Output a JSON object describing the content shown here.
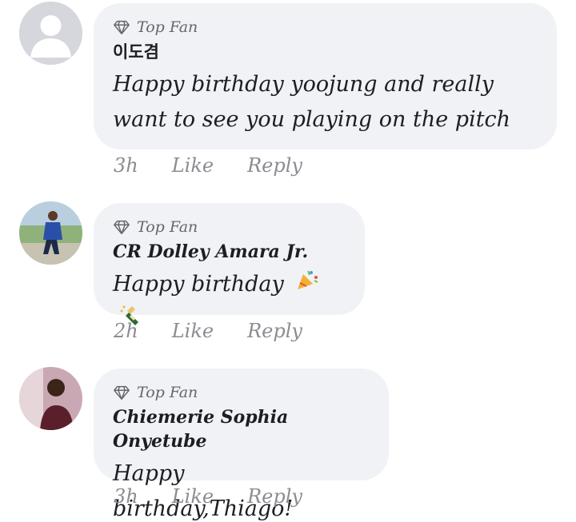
{
  "comments": [
    {
      "badge": "Top Fan",
      "author": "이도겸",
      "text_line1": "Happy birthday yoojung and really",
      "text_line2": "want to see you playing on the pitch",
      "time": "3h",
      "like_label": "Like",
      "reply_label": "Reply"
    },
    {
      "badge": "Top Fan",
      "author": "CR Dolley Amara Jr.",
      "text": "Happy birthday",
      "emojis": [
        "party-popper-icon",
        "champagne-bottle-icon"
      ],
      "time": "2h",
      "like_label": "Like",
      "reply_label": "Reply"
    },
    {
      "badge": "Top Fan",
      "author": "Chiemerie Sophia Onyetube",
      "text": "Happy birthday,Thiago!",
      "time": "3h",
      "like_label": "Like",
      "reply_label": "Reply"
    }
  ],
  "colors": {
    "bubble": "#f0f2f5",
    "meta_text": "#8a8d91",
    "badge_text": "#65676b",
    "primary_text": "#1c1e21"
  }
}
